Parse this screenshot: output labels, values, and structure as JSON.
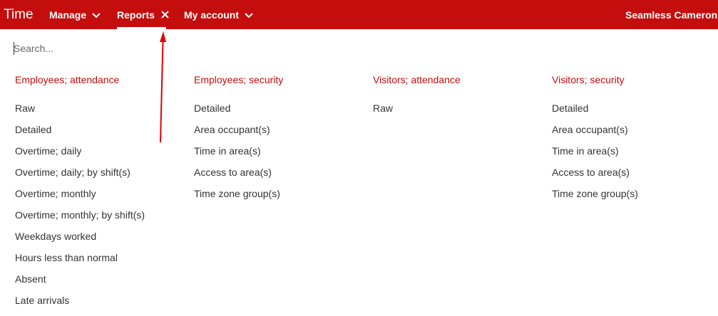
{
  "header": {
    "brand": "Time",
    "nav": [
      {
        "label": "Manage",
        "icon": "chevron-down-icon"
      },
      {
        "label": "Reports",
        "icon": "close-icon",
        "active": true
      },
      {
        "label": "My account",
        "icon": "chevron-down-icon"
      }
    ],
    "user": "Seamless Cameron Pl"
  },
  "search": {
    "placeholder": "Search..."
  },
  "columns": [
    {
      "heading": "Employees; attendance",
      "items": [
        "Raw",
        "Detailed",
        "Overtime; daily",
        "Overtime; daily; by shift(s)",
        "Overtime; monthly",
        "Overtime; monthly; by shift(s)",
        "Weekdays worked",
        "Hours less than normal",
        "Absent",
        "Late arrivals"
      ]
    },
    {
      "heading": "Employees; security",
      "items": [
        "Detailed",
        "Area occupant(s)",
        "Time in area(s)",
        "Access to area(s)",
        "Time zone group(s)"
      ]
    },
    {
      "heading": "Visitors; attendance",
      "items": [
        "Raw"
      ]
    },
    {
      "heading": "Visitors; security",
      "items": [
        "Detailed",
        "Area occupant(s)",
        "Time in area(s)",
        "Access to area(s)",
        "Time zone group(s)"
      ]
    }
  ],
  "colors": {
    "brand_red": "#c40d0d",
    "text": "#333333",
    "annotation_arrow": "#e00000"
  }
}
